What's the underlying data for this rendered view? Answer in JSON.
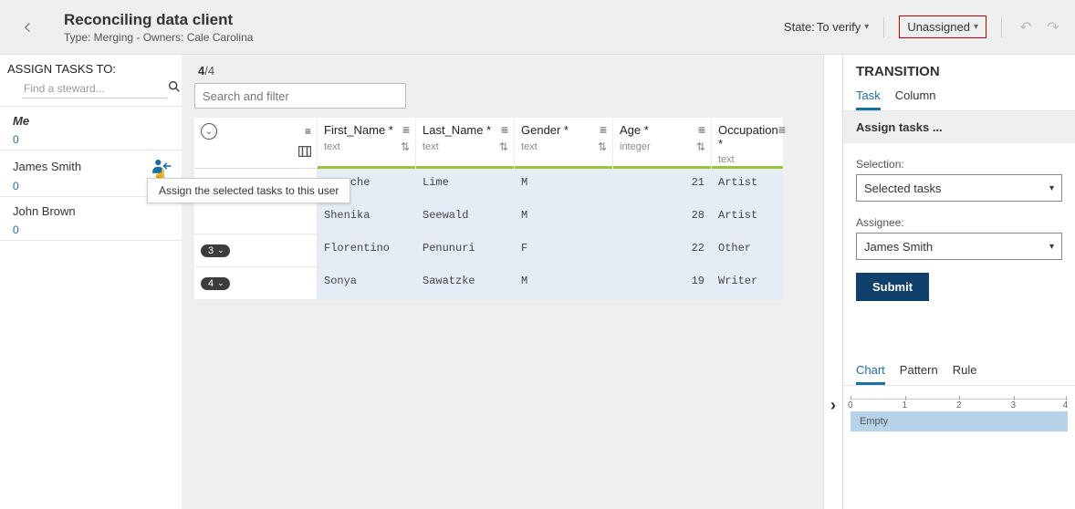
{
  "header": {
    "title": "Reconciling data client",
    "subtitle": "Type: Merging - Owners: Cale Carolina",
    "state_label": "State: ",
    "state_value": "To verify",
    "assignee": "Unassigned"
  },
  "sidebar": {
    "title": "ASSIGN TASKS TO:",
    "search_placeholder": "Find a steward...",
    "tooltip": "Assign the selected tasks to this user",
    "users": [
      {
        "name": "Me",
        "count": "0"
      },
      {
        "name": "James Smith",
        "count": "0"
      },
      {
        "name": "John Brown",
        "count": "0"
      }
    ]
  },
  "center": {
    "count_current": "4",
    "count_sep": "/",
    "count_total": "4",
    "search_placeholder": "Search and filter"
  },
  "grid": {
    "columns": [
      {
        "name": "First_Name *",
        "dtype": "text"
      },
      {
        "name": "Last_Name *",
        "dtype": "text"
      },
      {
        "name": "Gender *",
        "dtype": "text"
      },
      {
        "name": "Age *",
        "dtype": "integer"
      },
      {
        "name": "Occupation *",
        "dtype": "text"
      }
    ],
    "rows": [
      {
        "pill": "1",
        "first": "Porsche",
        "last": "Lime",
        "gender": "M",
        "age": "21",
        "occ": "Artist"
      },
      {
        "pill": "",
        "first": "Shenika",
        "last": "Seewald",
        "gender": "M",
        "age": "28",
        "occ": "Artist"
      },
      {
        "pill": "3",
        "first": "Florentino",
        "last": "Penunuri",
        "gender": "F",
        "age": "22",
        "occ": "Other"
      },
      {
        "pill": "4",
        "first": "Sonya",
        "last": "Sawatzke",
        "gender": "M",
        "age": "19",
        "occ": "Writer"
      }
    ]
  },
  "panel": {
    "heading": "TRANSITION",
    "tabs": [
      "Task",
      "Column"
    ],
    "bar": "Assign tasks ...",
    "selection_label": "Selection:",
    "selection_value": "Selected tasks",
    "assignee_label": "Assignee:",
    "assignee_value": "James Smith",
    "submit": "Submit",
    "lower_tabs": [
      "Chart",
      "Pattern",
      "Rule"
    ],
    "chart_empty": "Empty"
  },
  "chart_data": {
    "type": "bar",
    "title": "",
    "xlabel": "",
    "ylabel": "",
    "x_ticks": [
      "0",
      "1",
      "2",
      "3",
      "4"
    ],
    "categories": [
      "Empty"
    ],
    "values": [
      4
    ]
  }
}
